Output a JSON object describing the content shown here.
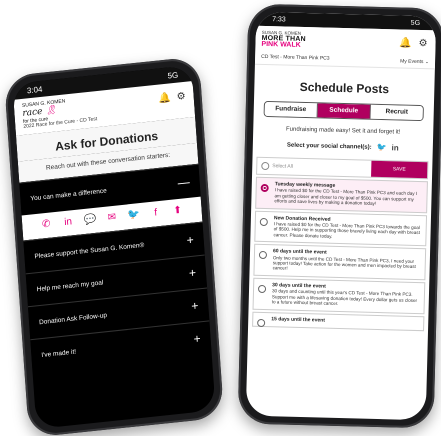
{
  "left_phone": {
    "status": {
      "time": "3:04",
      "signal": "5G"
    },
    "logo": {
      "line1": "SUSAN G. KOMEN",
      "race": "race",
      "for": "for the",
      "cure": "cure"
    },
    "subtitle": "2022 Race for the Cure - CD Test",
    "icons": [
      "bell-icon",
      "gear-icon"
    ],
    "title": "Ask for Donations",
    "intro": "Reach out with these conversation starters:",
    "rows": [
      {
        "label": "You can make a difference",
        "toggle": "—"
      },
      {
        "label": "Please support the Susan G. Komen®",
        "toggle": "+"
      },
      {
        "label": "Help me reach my goal",
        "toggle": "+"
      },
      {
        "label": "Donation Ask Follow-up",
        "toggle": "+"
      },
      {
        "label": "I've made it!",
        "toggle": "+"
      }
    ],
    "share_icons": [
      "whatsapp-icon",
      "linkedin-icon",
      "chat-icon",
      "email-icon",
      "twitter-icon",
      "facebook-icon",
      "app-icon"
    ],
    "accent_color": "#e5007e"
  },
  "right_phone": {
    "status": {
      "time": "7:33",
      "signal": "5G"
    },
    "logo": {
      "line1": "SUSAN G. KOMEN",
      "line2": "MORE THAN",
      "line3": "PINK WALK"
    },
    "subtitle": "CD Test - More Than Pink PC3",
    "events_label": "My Events",
    "icons": [
      "bell-icon",
      "gear-icon"
    ],
    "title": "Schedule Posts",
    "tabs": [
      "Fundraise",
      "Schedule",
      "Recruit"
    ],
    "active_tab": "Schedule",
    "intro": "Fundraising made easy! Set it and forget it!",
    "social_label": "Select your social channel(s):",
    "social_icons": [
      "twitter-icon",
      "linkedin-icon"
    ],
    "select_all": "Select All",
    "save_label": "SAVE",
    "posts": [
      {
        "title": "Tuesday weekly message",
        "body": "I have raised $0 for the CD Test - More Than Pink PC3 and each day I am getting closer and closer to my goal of $500. You can support my efforts and save lives by making a donation today!",
        "selected": true
      },
      {
        "title": "New Donation Received",
        "body": "I have raised $0 for the CD Test - More Than Pink PC3 towards the goal of $500. Help me in supporting those bravely living each day with breast cancer. Please donate today.",
        "selected": false
      },
      {
        "title": "60 days until the event",
        "body": "Only two months until the CD Test - More Than Pink PC3, I need your support today! Take action for the women and men impacted by breast cancer!",
        "selected": false
      },
      {
        "title": "30 days until the event",
        "body": "30 days and counting until this year's CD Test - More Than Pink PC3. Support me with a lifesaving donation today! Every dollar gets us closer to a future without breast cancer.",
        "selected": false
      },
      {
        "title": "15 days until the event",
        "body": "",
        "selected": false
      }
    ],
    "accent_color": "#b0005f"
  }
}
